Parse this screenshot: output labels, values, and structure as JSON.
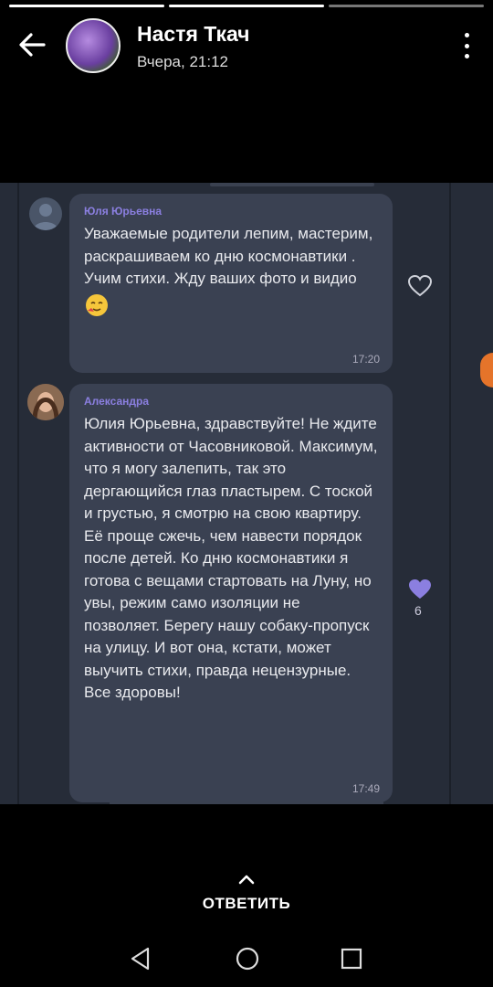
{
  "story": {
    "progress_total": 3,
    "progress_current": 2
  },
  "header": {
    "name": "Настя Ткач",
    "time": "Вчера, 21:12",
    "back_icon": "arrow-left-icon",
    "menu_icon": "more-vertical-icon"
  },
  "photo": {
    "messages": [
      {
        "sender": "Юля Юрьевна",
        "text": "Уважаемые родители лепим, мастерим, раскрашиваем ко дню космонавтики . Учим стихи. Жду ваших фото и видио",
        "emoji": "🥰",
        "time": "17:20",
        "reaction_count": ""
      },
      {
        "sender": "Александра",
        "text": "Юлия Юрьевна, здравствуйте! Не ждите активности от Часовниковой. Максимум, что я могу залепить, так это дергающийся глаз пластырем. С тоской и грустью, я смотрю на свою квартиру. Её проще сжечь, чем навести порядок после детей. Ко дню космонавтики я готова с вещами стартовать на Луну, но увы, режим само изоляции не позволяет. Берегу нашу собаку-пропуск на улицу. И вот она, кстати, может выучить стихи, правда нецензурные. Все здоровы!",
        "time": "17:49",
        "reaction_count": "6"
      }
    ]
  },
  "footer": {
    "reply_label": "ОТВЕТИТЬ"
  },
  "colors": {
    "sender_name": "#8b7fe0",
    "bubble": "#3a4152",
    "photo_bg": "#262c38",
    "heart_filled": "#8b7fe0"
  }
}
